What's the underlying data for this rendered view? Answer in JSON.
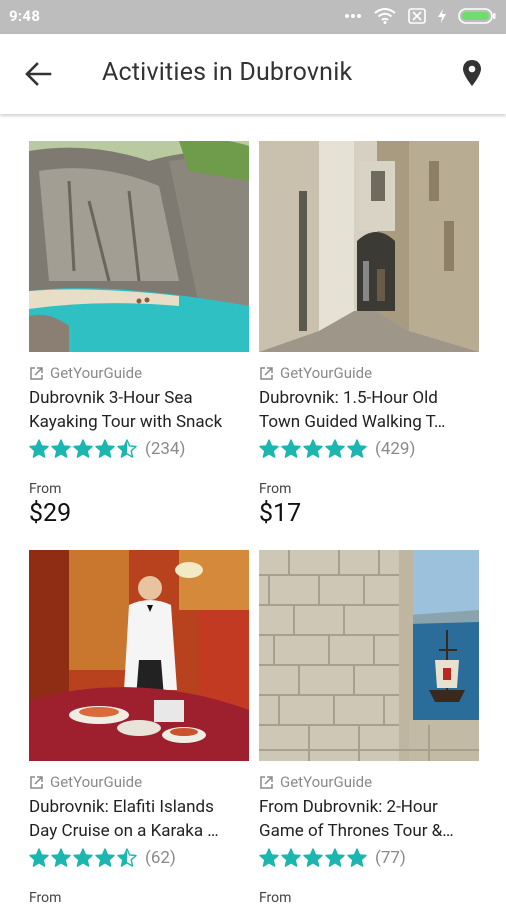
{
  "status_bar": {
    "time": "9:48"
  },
  "app_bar": {
    "title": "Activities in Dubrovnik"
  },
  "colors": {
    "star": "#1bb6b0",
    "status_bar": "#bdbdbd"
  },
  "cards": [
    {
      "source": "GetYourGuide",
      "title_line1": "Dubrovnik 3-Hour Sea",
      "title_line2": "Kayaking Tour with Snack",
      "rating": 4.5,
      "reviews": "(234)",
      "from_label": "From",
      "price": "$29",
      "image": "cliff and turquoise sea cove"
    },
    {
      "source": "GetYourGuide",
      "title_line1": "Dubrovnik: 1.5-Hour Old",
      "title_line2": "Town Guided Walking T…",
      "rating": 5,
      "reviews": "(429)",
      "from_label": "From",
      "price": "$17",
      "image": "narrow stone alley"
    },
    {
      "source": "GetYourGuide",
      "title_line1": "Dubrovnik: Elafiti Islands",
      "title_line2": "Day Cruise on a Karaka …",
      "rating": 4.5,
      "reviews": "(62)",
      "from_label": "From",
      "price": "",
      "image": "waiter with buffet in red restaurant"
    },
    {
      "source": "GetYourGuide",
      "title_line1": "From Dubrovnik: 2-Hour",
      "title_line2": "Game of Thrones Tour &…",
      "rating": 5,
      "reviews": "(77)",
      "from_label": "From",
      "price": "",
      "image": "stone wall with sea and ship"
    }
  ]
}
